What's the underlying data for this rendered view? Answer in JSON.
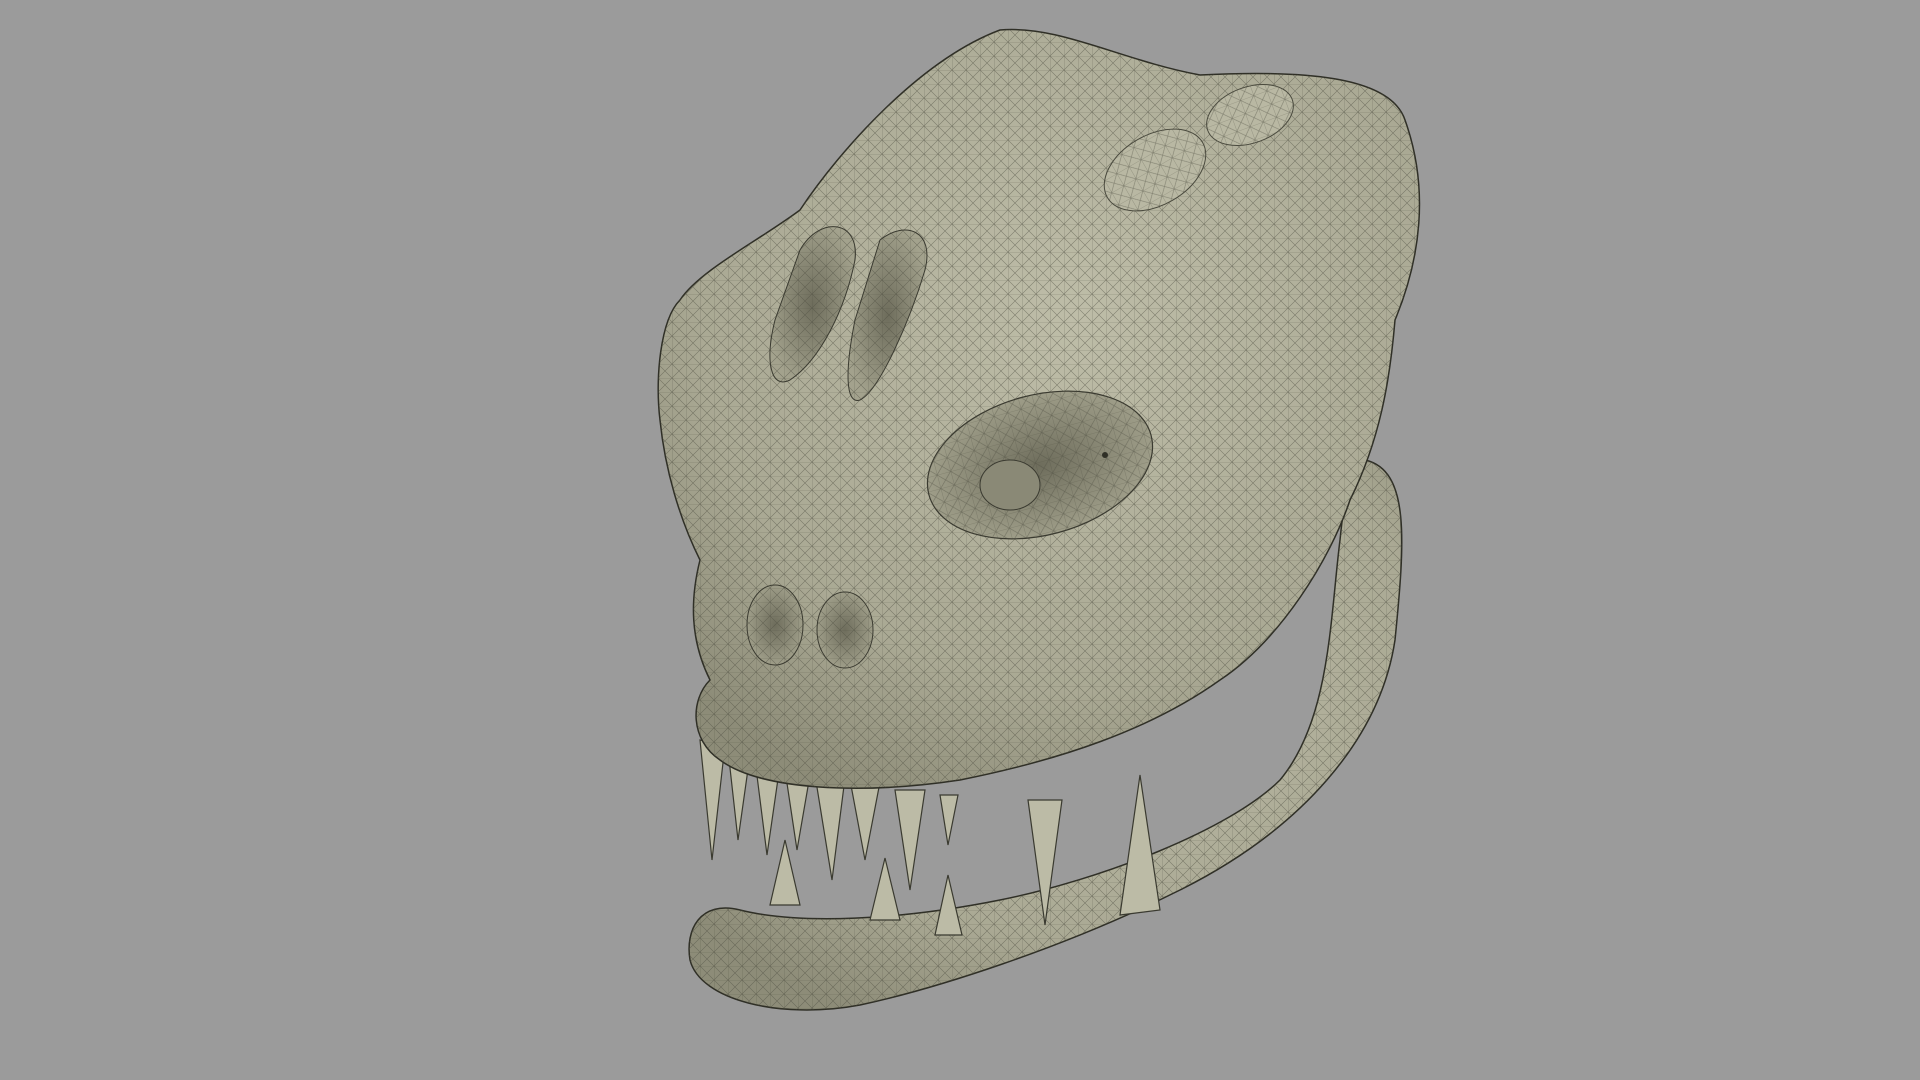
{
  "viewport": {
    "background_color": "#9b9b9b",
    "subject": "skull-mesh",
    "shading": "wireframe-on-shaded",
    "surface_color": "#b3b29d",
    "shadow_color": "#8d8c78",
    "wire_color": "#4a4a3e"
  }
}
